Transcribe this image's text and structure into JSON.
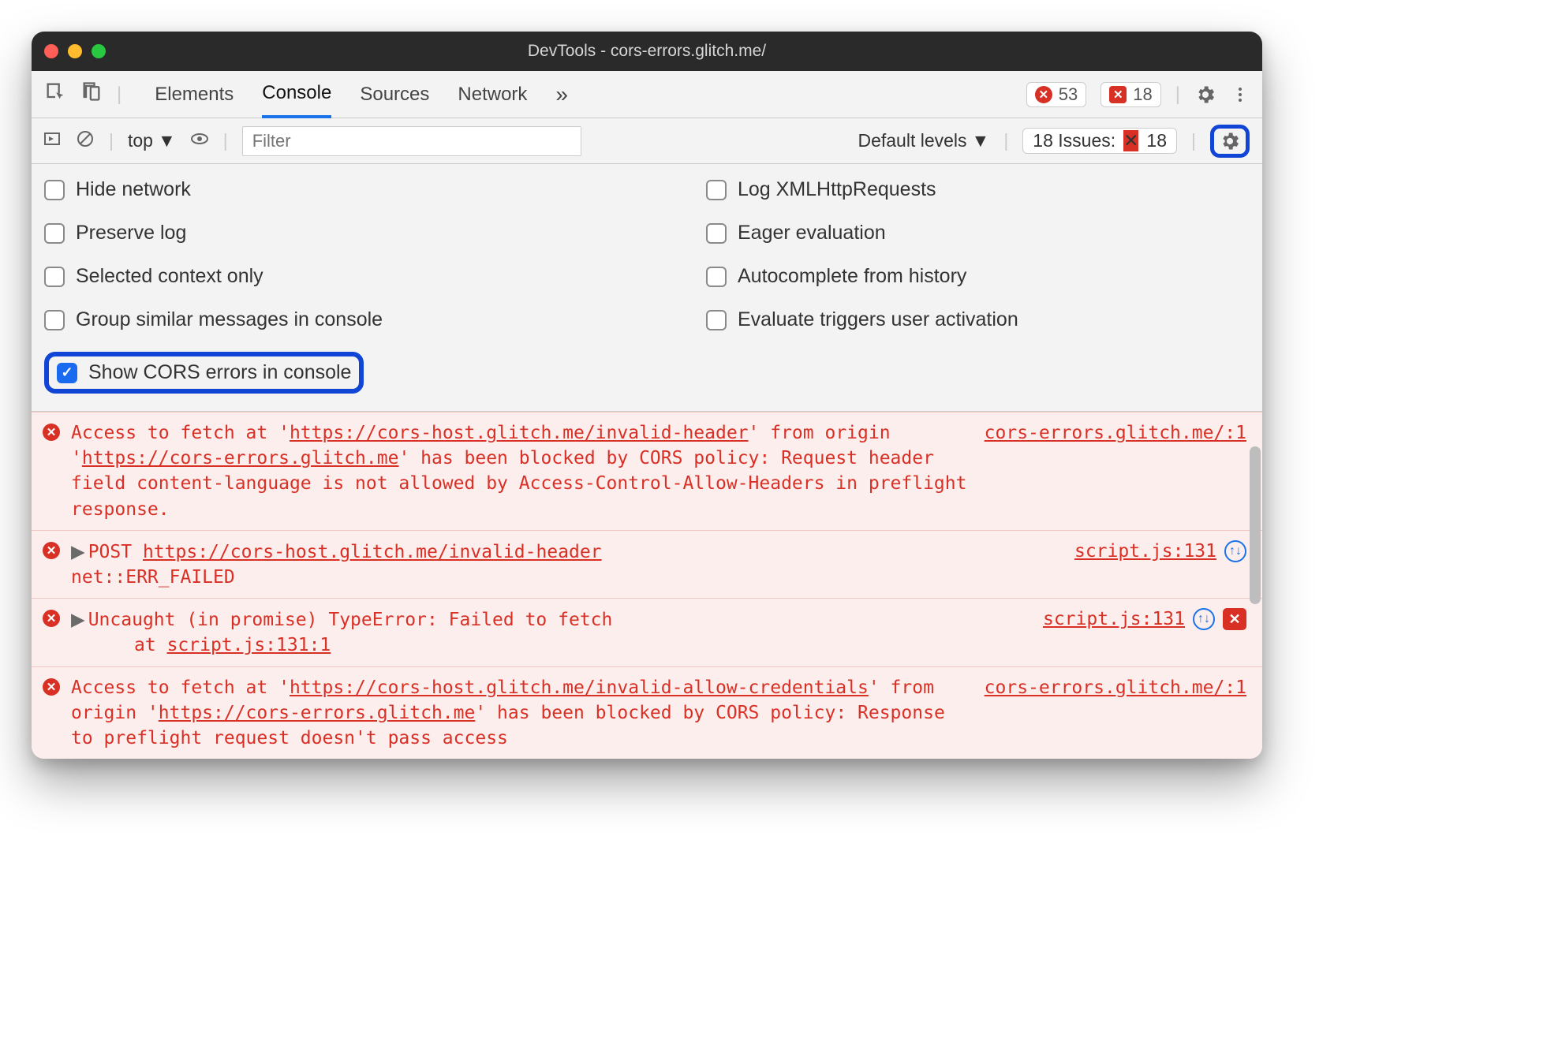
{
  "window": {
    "title": "DevTools - cors-errors.glitch.me/"
  },
  "tabs": {
    "items": [
      "Elements",
      "Console",
      "Sources",
      "Network"
    ],
    "active": "Console",
    "more": "»"
  },
  "counters": {
    "errors": "53",
    "issues": "18"
  },
  "subtoolbar": {
    "context": "top",
    "filter_placeholder": "Filter",
    "levels": "Default levels",
    "issues_label": "18 Issues:",
    "issues_count": "18"
  },
  "settings": {
    "left": [
      {
        "label": "Hide network",
        "checked": false
      },
      {
        "label": "Preserve log",
        "checked": false
      },
      {
        "label": "Selected context only",
        "checked": false
      },
      {
        "label": "Group similar messages in console",
        "checked": false
      },
      {
        "label": "Show CORS errors in console",
        "checked": true,
        "highlight": true
      }
    ],
    "right": [
      {
        "label": "Log XMLHttpRequests",
        "checked": false
      },
      {
        "label": "Eager evaluation",
        "checked": false
      },
      {
        "label": "Autocomplete from history",
        "checked": false
      },
      {
        "label": "Evaluate triggers user activation",
        "checked": false
      }
    ]
  },
  "logs": [
    {
      "type": "error",
      "text_pre": "Access to fetch at '",
      "url1": "https://cors-host.glitch.me/invalid-header",
      "text_mid": "' from origin '",
      "url2": "https://cors-errors.glitch.me",
      "text_post": "' has been blocked by CORS policy: Request header field content-language is not allowed by Access-Control-Allow-Headers in preflight response.",
      "source": "cors-errors.glitch.me/:1"
    },
    {
      "type": "error",
      "expandable": true,
      "method": "POST",
      "url": "https://cors-host.glitch.me/invalid-header",
      "status": "net::ERR_FAILED",
      "source": "script.js:131",
      "repeat": true
    },
    {
      "type": "error",
      "expandable": true,
      "msg": "Uncaught (in promise) TypeError: Failed to fetch",
      "at_label": "at",
      "at_loc": "script.js:131:1",
      "source": "script.js:131",
      "repeat": true,
      "issue": true
    },
    {
      "type": "error",
      "text_pre": "Access to fetch at '",
      "url1": "https://cors-host.glitch.me/invalid-allow-credentials",
      "text_mid": "' from origin '",
      "url2": "https://cors-errors.glitch.me",
      "text_post": "' has been blocked by CORS policy: Response to preflight request doesn't pass access",
      "source": "cors-errors.glitch.me/:1"
    }
  ]
}
